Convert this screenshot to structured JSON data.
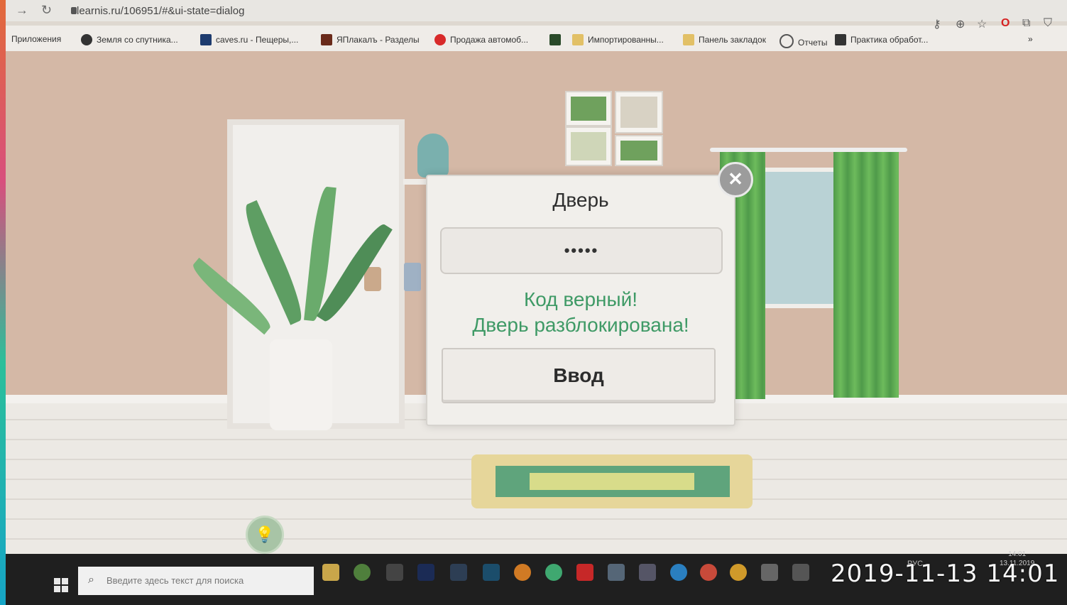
{
  "browser": {
    "url": "learnis.ru/106951/#&ui-state=dialog",
    "bookmarks": [
      {
        "label": "Приложения",
        "color": "#4a82d8"
      },
      {
        "label": "Земля со спутника...",
        "color": "#333333"
      },
      {
        "label": "caves.ru - Пещеры,...",
        "color": "#1d3b6e"
      },
      {
        "label": "ЯПлакалъ - Разделы",
        "color": "#6a2a1a"
      },
      {
        "label": "Продажа автомоб...",
        "color": "#d82a2a"
      },
      {
        "label": "Импортированны...",
        "color": "#e2c066"
      },
      {
        "label": "Панель закладок",
        "color": "#e2c066"
      },
      {
        "label": "Отчеты",
        "color": "#555555"
      },
      {
        "label": "Практика обработ...",
        "color": "#333333"
      }
    ]
  },
  "dialog": {
    "title": "Дверь",
    "code_value": "•••••",
    "success_line1": "Код верный!",
    "success_line2": "Дверь разблокирована!",
    "enter_label": "Ввод",
    "close_symbol": "✕"
  },
  "taskbar": {
    "search_placeholder": "Введите здесь текст для поиска",
    "tray_text": "РУС",
    "clock_time": "14:01",
    "clock_date": "13.11.2019"
  },
  "photo_timestamp": "2019-11-13 14:01"
}
